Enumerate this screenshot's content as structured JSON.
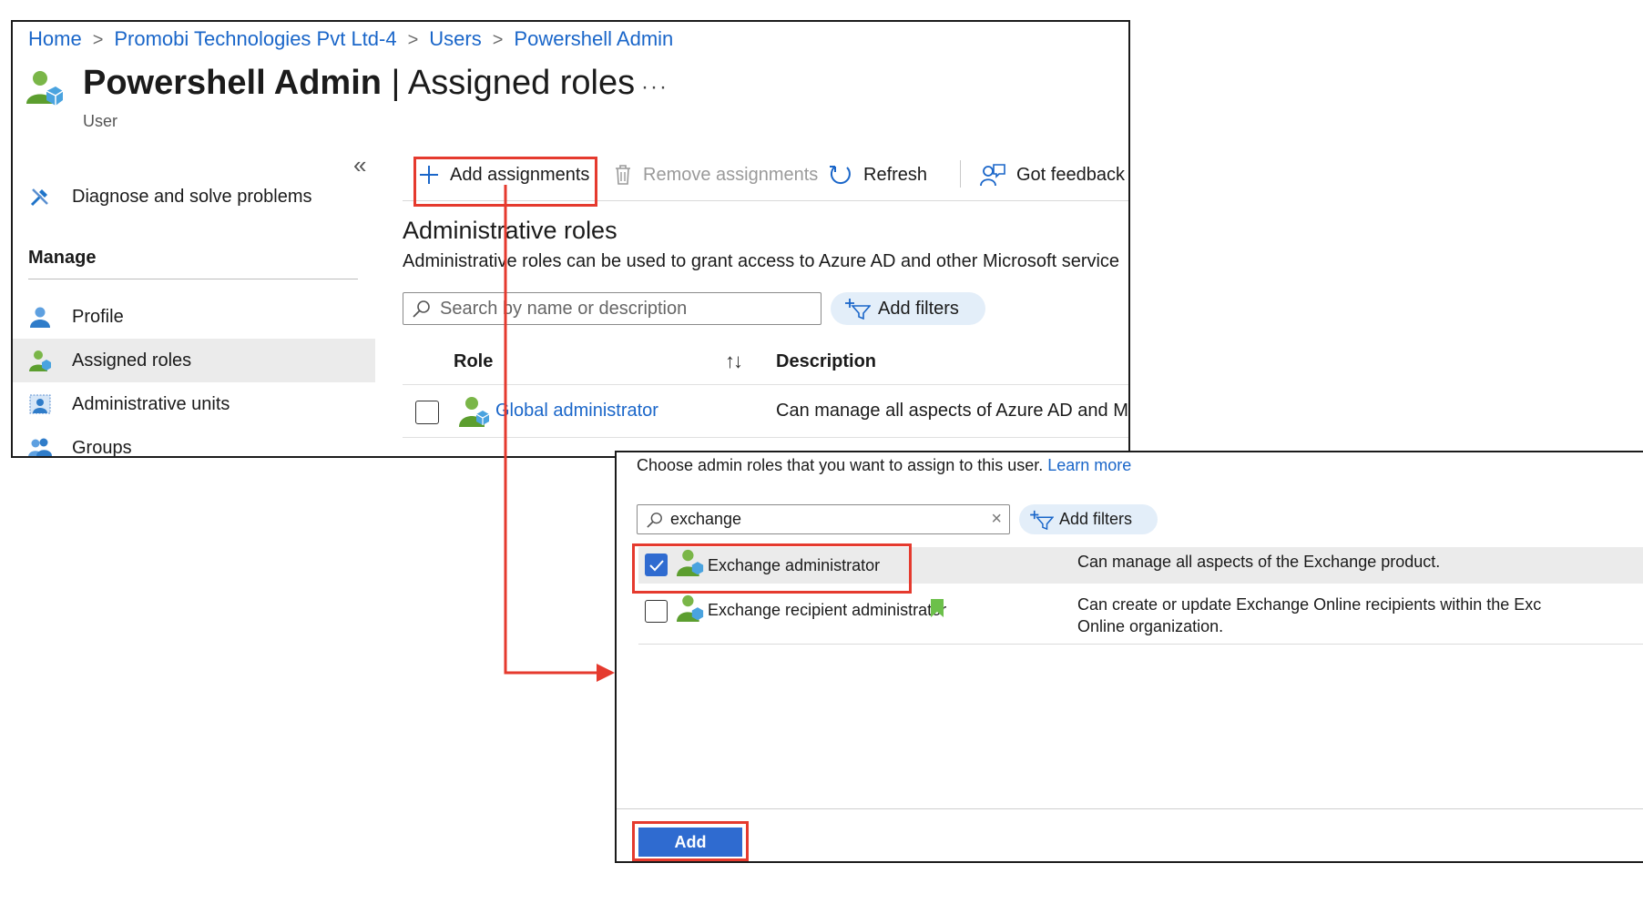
{
  "breadcrumb": {
    "items": [
      "Home",
      "Promobi Technologies Pvt Ltd-4",
      "Users",
      "Powershell Admin"
    ]
  },
  "header": {
    "title_bold": "Powershell Admin",
    "title_rest": " | Assigned roles",
    "subtitle": "User",
    "more": "···"
  },
  "sidebar": {
    "collapse": "«",
    "diagnose": "Diagnose and solve problems",
    "manage_heading": "Manage",
    "items": [
      "Profile",
      "Assigned roles",
      "Administrative units",
      "Groups"
    ],
    "selected": "Assigned roles"
  },
  "toolbar": {
    "add": "Add assignments",
    "remove": "Remove assignments",
    "refresh": "Refresh",
    "feedback": "Got feedback"
  },
  "section": {
    "title": "Administrative roles",
    "description": "Administrative roles can be used to grant access to Azure AD and other Microsoft service"
  },
  "search": {
    "placeholder": "Search by name or description",
    "add_filters": "Add filters"
  },
  "table": {
    "headers": [
      "Role",
      "Description"
    ],
    "sort_glyph": "↑↓",
    "rows": [
      {
        "role": "Global administrator",
        "description": "Can manage all aspects of Azure AD and M"
      }
    ]
  },
  "dialog": {
    "intro": "Choose admin roles that you want to assign to this user.",
    "learn_more": "Learn more",
    "search_value": "exchange",
    "clear": "×",
    "add_filters": "Add filters",
    "rows": [
      {
        "name": "Exchange administrator",
        "description": "Can manage all aspects of the Exchange product.",
        "checked": true
      },
      {
        "name": "Exchange recipient administrator",
        "description_line1": "Can create or update Exchange Online recipients within the Exc",
        "description_line2": "Online organization.",
        "checked": false
      }
    ],
    "add_button": "Add"
  },
  "colors": {
    "link": "#1a66c9",
    "highlight": "#e53a2e",
    "primary": "#2f6bd0",
    "selected_row": "#ebebeb",
    "filter_pill": "#e3eef9"
  }
}
